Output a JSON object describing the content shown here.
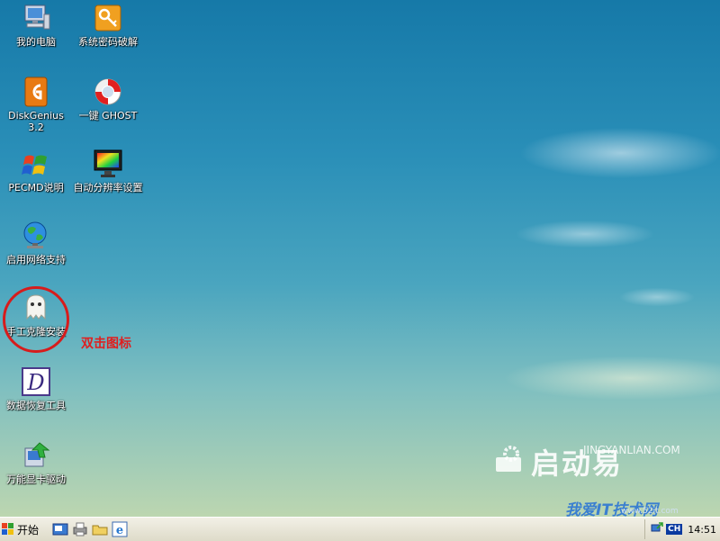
{
  "desktop": {
    "icons": [
      {
        "label": "我的电脑"
      },
      {
        "label": "系统密码破解"
      },
      {
        "label": "DiskGenius 3.2"
      },
      {
        "label": "一键 GHOST"
      },
      {
        "label": "PECMD说明"
      },
      {
        "label": "自动分辨率设置"
      },
      {
        "label": "启用网络支持"
      },
      {
        "label": "手工克隆安装"
      },
      {
        "label": "数据恢复工具"
      },
      {
        "label": "万能显卡驱动"
      }
    ],
    "annotation": "双击图标",
    "watermark": {
      "brand": "启动易",
      "url": "JINGYANLIAN.COM",
      "site": "我爱IT技术网",
      "site_url": "www.52it.com"
    }
  },
  "taskbar": {
    "start_label": "开始",
    "quick_launch": [
      "show-desktop-icon",
      "printer-icon",
      "folder-icon",
      "ie-icon"
    ],
    "tray": {
      "lang": "CH",
      "clock": "14:51"
    }
  },
  "colors": {
    "annotation": "#e01e1e",
    "taskbar": "#e9e7d8"
  }
}
